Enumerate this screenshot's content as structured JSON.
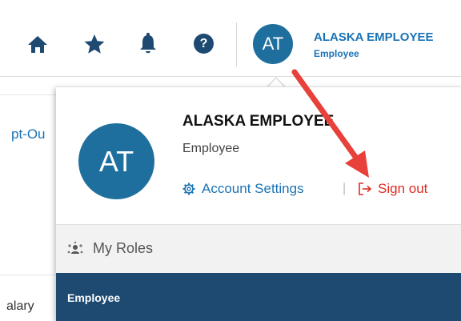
{
  "header": {
    "icons": [
      "home-icon",
      "star-icon",
      "bell-icon",
      "help-icon"
    ],
    "help_glyph": "?",
    "user": {
      "initials": "AT",
      "name": "ALASKA EMPLOYEE",
      "role": "Employee"
    }
  },
  "background": {
    "partial_text_1": "pt-Ou",
    "partial_text_2": "alary"
  },
  "dropdown": {
    "initials": "AT",
    "name": "ALASKA EMPLOYEE",
    "role": "Employee",
    "account_settings_label": "Account Settings",
    "separator": "|",
    "sign_out_label": "Sign out",
    "my_roles_label": "My Roles",
    "roles": [
      "Employee"
    ]
  },
  "colors": {
    "accent_blue": "#1a73b5",
    "avatar_blue": "#1f6f9e",
    "navy": "#1e4a72",
    "sign_out_red": "#e02b20",
    "annotation_arrow": "#e8403a"
  }
}
